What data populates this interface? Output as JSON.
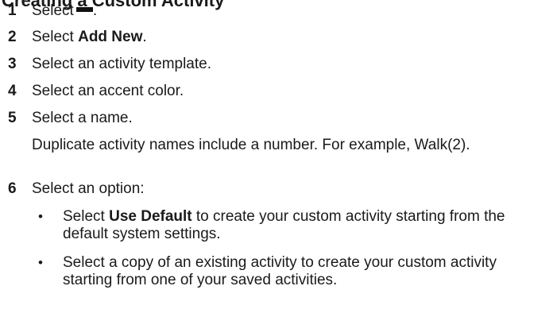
{
  "heading": "Creating a Custom Activity",
  "steps": [
    {
      "num": "1",
      "pre": "Select",
      "icon": "menu-icon",
      "post": "."
    },
    {
      "num": "2",
      "pre": "Select ",
      "bold": "Add New",
      "post": "."
    },
    {
      "num": "3",
      "text": "Select an activity template."
    },
    {
      "num": "4",
      "text": "Select an accent color."
    },
    {
      "num": "5",
      "text": "Select a name.",
      "note": "Duplicate activity names include a number. For example, Walk(2)."
    },
    {
      "num": "6",
      "text": "Select an option:"
    }
  ],
  "options": [
    {
      "bullet": "•",
      "pre": "Select ",
      "bold": "Use Default",
      "post": " to create your custom activity starting from the default system settings."
    },
    {
      "bullet": "•",
      "text": "Select a copy of an existing activity to create your custom activity starting from one of your saved activities."
    }
  ]
}
